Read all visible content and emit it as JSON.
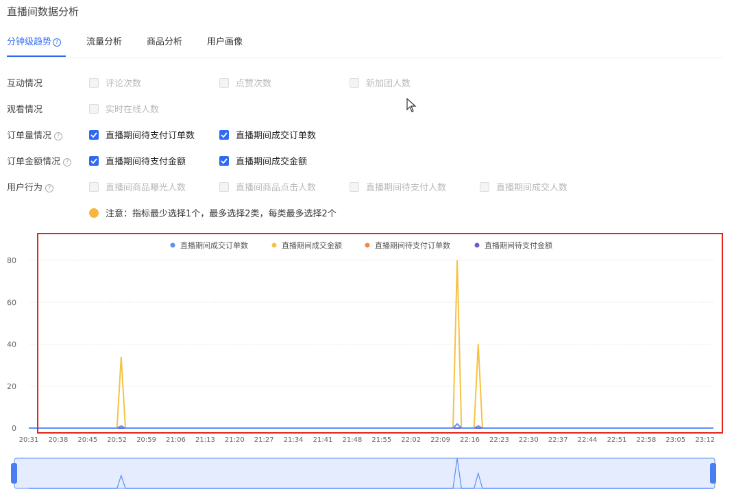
{
  "page": {
    "title": "直播间数据分析"
  },
  "tabs": [
    {
      "label": "分钟级趋势",
      "active": true,
      "help_icon": "question-circle-icon"
    },
    {
      "label": "流量分析",
      "active": false
    },
    {
      "label": "商品分析",
      "active": false
    },
    {
      "label": "用户画像",
      "active": false
    }
  ],
  "filters": {
    "interaction": {
      "label": "互动情况",
      "options": [
        {
          "label": "评论次数",
          "checked": false,
          "disabled": true
        },
        {
          "label": "点赞次数",
          "checked": false,
          "disabled": true
        },
        {
          "label": "新加团人数",
          "checked": false,
          "disabled": true
        }
      ]
    },
    "viewing": {
      "label": "观看情况",
      "options": [
        {
          "label": "实时在线人数",
          "checked": false,
          "disabled": true
        }
      ]
    },
    "order_count": {
      "label": "订单量情况",
      "help_icon": "question-circle-icon",
      "options": [
        {
          "label": "直播期间待支付订单数",
          "checked": true,
          "disabled": false
        },
        {
          "label": "直播期间成交订单数",
          "checked": true,
          "disabled": false
        }
      ]
    },
    "order_amount": {
      "label": "订单金额情况",
      "help_icon": "question-circle-icon",
      "options": [
        {
          "label": "直播期间待支付金额",
          "checked": true,
          "disabled": false
        },
        {
          "label": "直播期间成交金额",
          "checked": true,
          "disabled": false
        }
      ]
    },
    "user_behavior": {
      "label": "用户行为",
      "help_icon": "question-circle-icon",
      "options": [
        {
          "label": "直播间商品曝光人数",
          "checked": false,
          "disabled": true
        },
        {
          "label": "直播间商品点击人数",
          "checked": false,
          "disabled": true
        },
        {
          "label": "直播期间待支付人数",
          "checked": false,
          "disabled": true
        },
        {
          "label": "直播期间成交人数",
          "checked": false,
          "disabled": true
        }
      ]
    }
  },
  "notice": {
    "icon": "warning-circle-icon",
    "text": "注意：指标最少选择1个，最多选择2类，每类最多选择2个"
  },
  "colors": {
    "accent": "#2f6bf2",
    "highlight_border": "#e1251b",
    "notice": "#f6b73c"
  },
  "chart_data": {
    "type": "line",
    "legend_position": "top-center",
    "grid": true,
    "ylim": [
      0,
      80
    ],
    "yticks": [
      "0",
      "20",
      "40",
      "60",
      "80"
    ],
    "x_tick_labels": [
      "20:31",
      "20:38",
      "20:45",
      "20:52",
      "20:59",
      "21:06",
      "21:13",
      "21:20",
      "21:27",
      "21:34",
      "21:41",
      "21:48",
      "21:55",
      "22:02",
      "22:09",
      "22:16",
      "22:23",
      "22:30",
      "22:37",
      "22:44",
      "22:51",
      "22:58",
      "23:05",
      "23:12"
    ],
    "series": [
      {
        "name": "直播期间成交订单数",
        "color": "#5b8ff9",
        "points": [
          [
            "20:31",
            0
          ],
          [
            "20:52",
            0
          ],
          [
            "20:53",
            1
          ],
          [
            "20:54",
            0
          ],
          [
            "22:12",
            0
          ],
          [
            "22:13",
            2
          ],
          [
            "22:14",
            0
          ],
          [
            "22:17",
            0
          ],
          [
            "22:18",
            1
          ],
          [
            "22:19",
            0
          ],
          [
            "23:14",
            0
          ]
        ]
      },
      {
        "name": "直播期间成交金额",
        "color": "#f6c244",
        "points": [
          [
            "20:31",
            0
          ],
          [
            "20:52",
            0
          ],
          [
            "20:53",
            34
          ],
          [
            "20:54",
            0
          ],
          [
            "22:12",
            0
          ],
          [
            "22:13",
            80
          ],
          [
            "22:14",
            0
          ],
          [
            "22:17",
            0
          ],
          [
            "22:18",
            40
          ],
          [
            "22:19",
            0
          ],
          [
            "23:14",
            0
          ]
        ]
      },
      {
        "name": "直播期间待支付订单数",
        "color": "#f4874b",
        "points": [
          [
            "20:31",
            0
          ],
          [
            "23:14",
            0
          ]
        ]
      },
      {
        "name": "直播期间待支付金额",
        "color": "#6b5bd6",
        "points": [
          [
            "20:31",
            0
          ],
          [
            "23:14",
            0
          ]
        ]
      }
    ]
  }
}
